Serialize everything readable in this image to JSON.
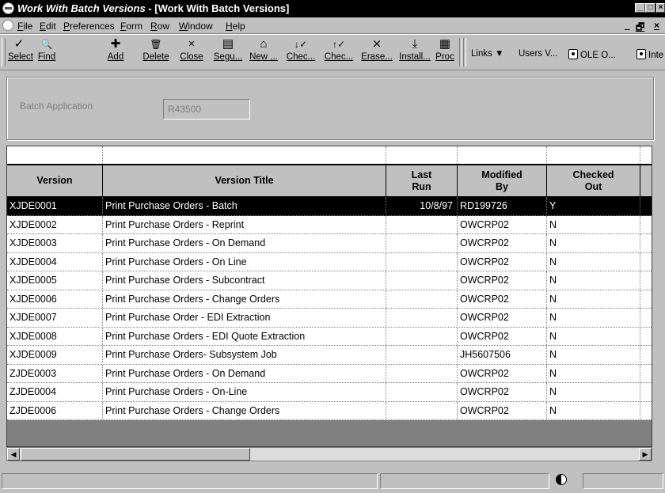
{
  "window": {
    "title_italic": "Work With Batch Versions",
    "title_rest": " - [Work With Batch Versions]",
    "controls": [
      "_",
      "□",
      "×"
    ],
    "mdi_controls": [
      "_",
      "🗗",
      "×"
    ]
  },
  "menu": [
    "File",
    "Edit",
    "Preferences",
    "Form",
    "Row",
    "Window",
    "Help"
  ],
  "toolbar": {
    "buttons": [
      {
        "label": "Select",
        "icon": "✓"
      },
      {
        "label": "Find",
        "icon": "🔍"
      },
      {
        "label": "Add",
        "icon": "✚"
      },
      {
        "label": "Delete",
        "icon": "🗑"
      },
      {
        "label": "Close",
        "icon": "×"
      },
      {
        "label": "Segu...",
        "icon": "▤"
      },
      {
        "label": "New ...",
        "icon": "⌂"
      },
      {
        "label": "Chec...",
        "icon": "↓✓"
      },
      {
        "label": "Chec...",
        "icon": "↑✓"
      },
      {
        "label": "Erase...",
        "icon": "⨯"
      },
      {
        "label": "Install...",
        "icon": "⤓"
      },
      {
        "label": "Proc",
        "icon": "▦"
      }
    ],
    "exits": {
      "links": "Links",
      "users": "Users V...",
      "ole": "OLE O...",
      "inte": "Inte"
    }
  },
  "header": {
    "batch_label": "Batch Application",
    "batch_value": "R43500"
  },
  "grid": {
    "columns": [
      "Version",
      "Version Title",
      "Last\nRun",
      "Modified\nBy",
      "Checked\nOut"
    ],
    "rows": [
      {
        "version": "XJDE0001",
        "title": "Print Purchase Orders - Batch",
        "last_run": "10/8/97",
        "modified_by": "RD199726",
        "checked_out": "Y"
      },
      {
        "version": "XJDE0002",
        "title": "Print Purchase Orders - Reprint",
        "last_run": "",
        "modified_by": "OWCRP02",
        "checked_out": "N"
      },
      {
        "version": "XJDE0003",
        "title": "Print Purchase Orders - On Demand",
        "last_run": "",
        "modified_by": "OWCRP02",
        "checked_out": "N"
      },
      {
        "version": "XJDE0004",
        "title": "Print Purchase Orders - On Line",
        "last_run": "",
        "modified_by": "OWCRP02",
        "checked_out": "N"
      },
      {
        "version": "XJDE0005",
        "title": "Print Purchase Orders - Subcontract",
        "last_run": "",
        "modified_by": "OWCRP02",
        "checked_out": "N"
      },
      {
        "version": "XJDE0006",
        "title": "Print Purchase Orders - Change Orders",
        "last_run": "",
        "modified_by": "OWCRP02",
        "checked_out": "N"
      },
      {
        "version": "XJDE0007",
        "title": "Print Purchase Order - EDI Extraction",
        "last_run": "",
        "modified_by": "OWCRP02",
        "checked_out": "N"
      },
      {
        "version": "XJDE0008",
        "title": "Print Purchase Orders - EDI Quote Extraction",
        "last_run": "",
        "modified_by": "OWCRP02",
        "checked_out": "N"
      },
      {
        "version": "XJDE0009",
        "title": "Print Purchase Orders- Subsystem Job",
        "last_run": "",
        "modified_by": "JH5607506",
        "checked_out": "N"
      },
      {
        "version": "ZJDE0003",
        "title": "Print Purchase Orders - On Demand",
        "last_run": "",
        "modified_by": "OWCRP02",
        "checked_out": "N"
      },
      {
        "version": "ZJDE0004",
        "title": "Print Purchase Orders - On-Line",
        "last_run": "",
        "modified_by": "OWCRP02",
        "checked_out": "N"
      },
      {
        "version": "ZJDE0006",
        "title": "Print Purchase Orders - Change Orders",
        "last_run": "",
        "modified_by": "OWCRP02",
        "checked_out": "N"
      }
    ],
    "selected_row": 0
  },
  "scroll": {
    "left_arrow": "◀",
    "right_arrow": "▶"
  }
}
